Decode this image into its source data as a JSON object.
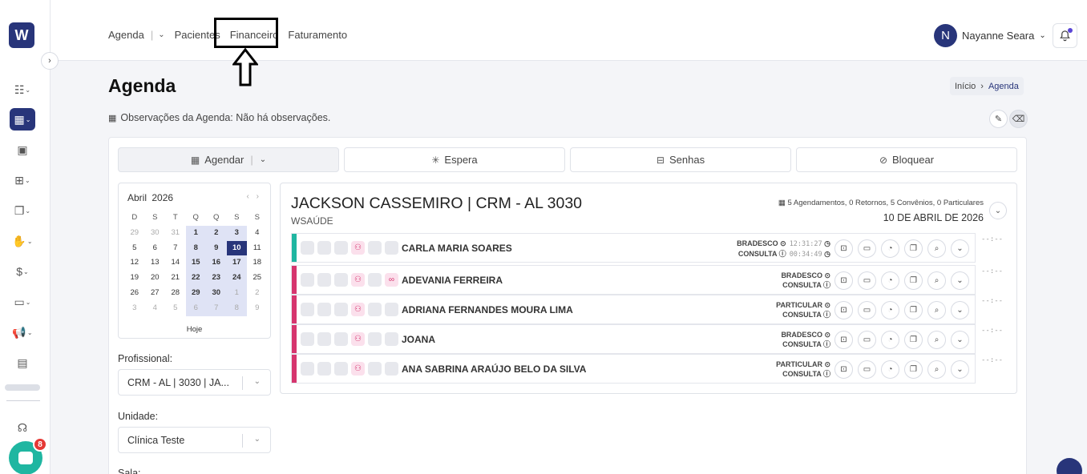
{
  "sidebar": {
    "logo": "W",
    "chat_badge": "8"
  },
  "nav": {
    "agenda": "Agenda",
    "pacientes": "Pacientes",
    "financeiro": "Financeiro",
    "faturamento": "Faturamento"
  },
  "user": {
    "initial": "N",
    "name": "Nayanne Seara"
  },
  "page": {
    "title": "Agenda",
    "breadcrumb": {
      "home": "Início",
      "current": "Agenda"
    },
    "observations": "Observações da Agenda: Não há observações."
  },
  "actions": {
    "agendar": "Agendar",
    "espera": "Espera",
    "senhas": "Senhas",
    "bloquear": "Bloquear"
  },
  "calendar": {
    "month": "Abril",
    "year": "2026",
    "weekdays": [
      "D",
      "S",
      "T",
      "Q",
      "Q",
      "S",
      "S"
    ],
    "today_label": "Hoje",
    "weeks": [
      [
        "29",
        "30",
        "31",
        "1",
        "2",
        "3",
        "4"
      ],
      [
        "5",
        "6",
        "7",
        "8",
        "9",
        "10",
        "11"
      ],
      [
        "12",
        "13",
        "14",
        "15",
        "16",
        "17",
        "18"
      ],
      [
        "19",
        "20",
        "21",
        "22",
        "23",
        "24",
        "25"
      ],
      [
        "26",
        "27",
        "28",
        "29",
        "30",
        "1",
        "2"
      ],
      [
        "3",
        "4",
        "5",
        "6",
        "7",
        "8",
        "9"
      ]
    ]
  },
  "filters": {
    "profissional_label": "Profissional:",
    "profissional_value": "CRM - AL | 3030 | JA...",
    "unidade_label": "Unidade:",
    "unidade_value": "Clínica Teste",
    "sala_label": "Sala:"
  },
  "doctor": {
    "name": "JACKSON CASSEMIRO | CRM - AL 3030",
    "unit": "WSAÚDE",
    "summary": "5 Agendamentos, 0 Retornos, 5 Convênios, 0 Particulares",
    "date": "10 DE ABRIL DE 2026"
  },
  "appointments": [
    {
      "name": "CARLA MARIA SOARES",
      "plan": "BRADESCO",
      "type": "CONSULTA",
      "time1": "12:31:27",
      "time2": "00:34:49",
      "time_right": "--:--",
      "color": "#1fb6a1"
    },
    {
      "name": "ADEVANIA FERREIRA",
      "plan": "BRADESCO",
      "type": "CONSULTA",
      "time_right": "--:--",
      "color": "#d6356e"
    },
    {
      "name": "ADRIANA FERNANDES MOURA LIMA",
      "plan": "PARTICULAR",
      "type": "CONSULTA",
      "time_right": "--:--",
      "color": "#d6356e"
    },
    {
      "name": "JOANA",
      "plan": "BRADESCO",
      "type": "CONSULTA",
      "time_right": "--:--",
      "color": "#d6356e"
    },
    {
      "name": "ANA SABRINA ARAÚJO BELO DA SILVA",
      "plan": "PARTICULAR",
      "type": "CONSULTA",
      "time_right": "--:--",
      "color": "#d6356e"
    }
  ]
}
